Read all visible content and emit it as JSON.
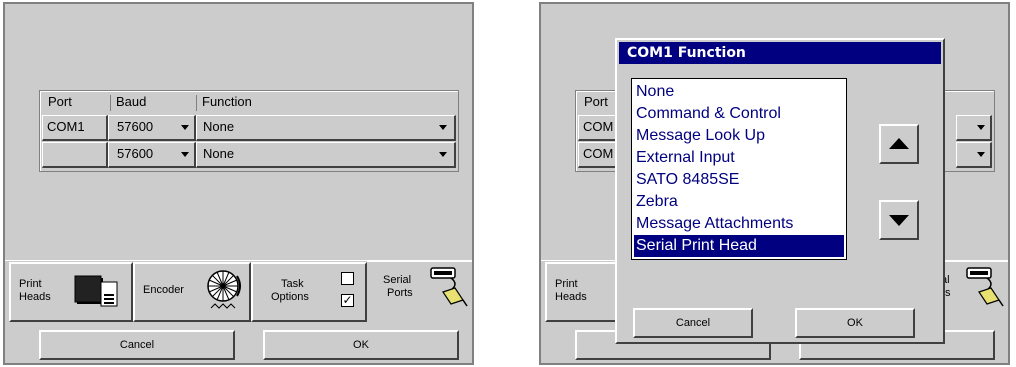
{
  "left": {
    "table": {
      "headers": [
        "Port",
        "Baud",
        "Function"
      ],
      "rows": [
        {
          "port": "COM1",
          "baud": "57600",
          "function": "None"
        },
        {
          "port": "",
          "baud": "57600",
          "function": "None"
        }
      ]
    },
    "tabs": {
      "print_heads": [
        "Print",
        "Heads"
      ],
      "encoder": "Encoder",
      "task_options": [
        "Task",
        "Options"
      ],
      "serial_ports": [
        "Serial",
        "Ports"
      ]
    },
    "buttons": {
      "cancel": "Cancel",
      "ok": "OK"
    }
  },
  "right": {
    "background": {
      "port_header": "Port",
      "row1_port": "COM",
      "row2_port": "COM",
      "print_heads": [
        "Print",
        "Heads"
      ],
      "serial_fragment": [
        "al",
        "s"
      ]
    },
    "dialog": {
      "title": "COM1 Function",
      "options": [
        "None",
        "Command & Control",
        "Message Look Up",
        "External Input",
        "SATO 8485SE",
        "Zebra",
        "Message Attachments",
        "Serial Print Head"
      ],
      "selected": "Serial Print Head",
      "buttons": {
        "cancel": "Cancel",
        "ok": "OK"
      }
    }
  },
  "colors": {
    "titlebar": "#000080",
    "list_text": "#000080",
    "panel": "#cccccc"
  }
}
